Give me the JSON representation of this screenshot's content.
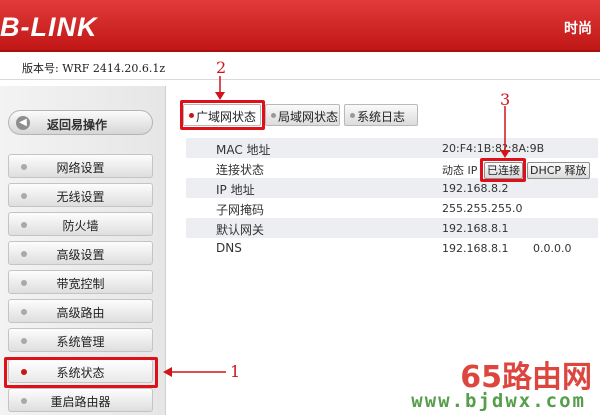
{
  "header": {
    "logo": "B-LINK",
    "slogan": "时尚"
  },
  "version": "版本号: WRF 2414.20.6.1z",
  "sidebar": {
    "back_label": "返回易操作",
    "items": [
      {
        "label": "网络设置"
      },
      {
        "label": "无线设置"
      },
      {
        "label": "防火墙"
      },
      {
        "label": "高级设置"
      },
      {
        "label": "带宽控制"
      },
      {
        "label": "高级路由"
      },
      {
        "label": "系统管理"
      },
      {
        "label": "系统状态"
      },
      {
        "label": "重启路由器"
      }
    ]
  },
  "tabs": [
    {
      "label": "广域网状态"
    },
    {
      "label": "局域网状态"
    },
    {
      "label": "系统日志"
    }
  ],
  "status": {
    "rows": [
      {
        "key": "MAC 地址",
        "value": "20:F4:1B:8?:8A:9B"
      },
      {
        "key": "连接状态",
        "value": "动态 IP"
      },
      {
        "key": "IP 地址",
        "value": "192.168.8.2"
      },
      {
        "key": "子网掩码",
        "value": "255.255.255.0"
      },
      {
        "key": "默认网关",
        "value": "192.168.8.1"
      },
      {
        "key": "DNS",
        "value": "192.168.8.1       0.0.0.0"
      }
    ],
    "connected_label": "已连接",
    "dhcp_release_label": "DHCP 释放"
  },
  "annotations": {
    "n1": "1",
    "n2": "2",
    "n3": "3"
  },
  "watermark": {
    "text": "65路由网",
    "url": "www.bjdwx.com"
  },
  "colors": {
    "brand_red": "#c01616",
    "highlight": "#e0101a",
    "active_dot": "#cc1414"
  }
}
